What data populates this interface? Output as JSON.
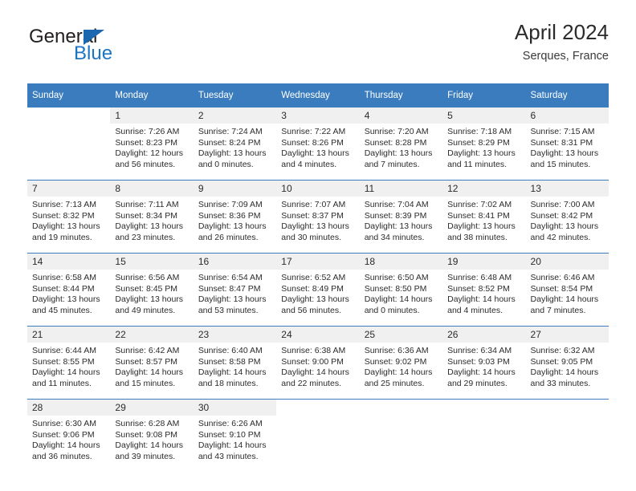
{
  "brand": {
    "name_top": "General",
    "name_bottom": "Blue",
    "triangle_color": "#1c68b0",
    "blue_color": "#1c74c4"
  },
  "header": {
    "title": "April 2024",
    "location": "Serques, France"
  },
  "theme": {
    "header_row_bg": "#3a7cbe",
    "daynum_bg": "#f0f0f0",
    "text_color": "#2b2b2b"
  },
  "weekday_headers": [
    "Sunday",
    "Monday",
    "Tuesday",
    "Wednesday",
    "Thursday",
    "Friday",
    "Saturday"
  ],
  "labels": {
    "sunrise_prefix": "Sunrise:",
    "sunset_prefix": "Sunset:",
    "daylight_prefix": "Daylight:"
  },
  "weeks": [
    [
      {
        "day": "",
        "sunrise": "",
        "sunset": "",
        "daylight": ""
      },
      {
        "day": "1",
        "sunrise": "Sunrise: 7:26 AM",
        "sunset": "Sunset: 8:23 PM",
        "daylight": "Daylight: 12 hours and 56 minutes."
      },
      {
        "day": "2",
        "sunrise": "Sunrise: 7:24 AM",
        "sunset": "Sunset: 8:24 PM",
        "daylight": "Daylight: 13 hours and 0 minutes."
      },
      {
        "day": "3",
        "sunrise": "Sunrise: 7:22 AM",
        "sunset": "Sunset: 8:26 PM",
        "daylight": "Daylight: 13 hours and 4 minutes."
      },
      {
        "day": "4",
        "sunrise": "Sunrise: 7:20 AM",
        "sunset": "Sunset: 8:28 PM",
        "daylight": "Daylight: 13 hours and 7 minutes."
      },
      {
        "day": "5",
        "sunrise": "Sunrise: 7:18 AM",
        "sunset": "Sunset: 8:29 PM",
        "daylight": "Daylight: 13 hours and 11 minutes."
      },
      {
        "day": "6",
        "sunrise": "Sunrise: 7:15 AM",
        "sunset": "Sunset: 8:31 PM",
        "daylight": "Daylight: 13 hours and 15 minutes."
      }
    ],
    [
      {
        "day": "7",
        "sunrise": "Sunrise: 7:13 AM",
        "sunset": "Sunset: 8:32 PM",
        "daylight": "Daylight: 13 hours and 19 minutes."
      },
      {
        "day": "8",
        "sunrise": "Sunrise: 7:11 AM",
        "sunset": "Sunset: 8:34 PM",
        "daylight": "Daylight: 13 hours and 23 minutes."
      },
      {
        "day": "9",
        "sunrise": "Sunrise: 7:09 AM",
        "sunset": "Sunset: 8:36 PM",
        "daylight": "Daylight: 13 hours and 26 minutes."
      },
      {
        "day": "10",
        "sunrise": "Sunrise: 7:07 AM",
        "sunset": "Sunset: 8:37 PM",
        "daylight": "Daylight: 13 hours and 30 minutes."
      },
      {
        "day": "11",
        "sunrise": "Sunrise: 7:04 AM",
        "sunset": "Sunset: 8:39 PM",
        "daylight": "Daylight: 13 hours and 34 minutes."
      },
      {
        "day": "12",
        "sunrise": "Sunrise: 7:02 AM",
        "sunset": "Sunset: 8:41 PM",
        "daylight": "Daylight: 13 hours and 38 minutes."
      },
      {
        "day": "13",
        "sunrise": "Sunrise: 7:00 AM",
        "sunset": "Sunset: 8:42 PM",
        "daylight": "Daylight: 13 hours and 42 minutes."
      }
    ],
    [
      {
        "day": "14",
        "sunrise": "Sunrise: 6:58 AM",
        "sunset": "Sunset: 8:44 PM",
        "daylight": "Daylight: 13 hours and 45 minutes."
      },
      {
        "day": "15",
        "sunrise": "Sunrise: 6:56 AM",
        "sunset": "Sunset: 8:45 PM",
        "daylight": "Daylight: 13 hours and 49 minutes."
      },
      {
        "day": "16",
        "sunrise": "Sunrise: 6:54 AM",
        "sunset": "Sunset: 8:47 PM",
        "daylight": "Daylight: 13 hours and 53 minutes."
      },
      {
        "day": "17",
        "sunrise": "Sunrise: 6:52 AM",
        "sunset": "Sunset: 8:49 PM",
        "daylight": "Daylight: 13 hours and 56 minutes."
      },
      {
        "day": "18",
        "sunrise": "Sunrise: 6:50 AM",
        "sunset": "Sunset: 8:50 PM",
        "daylight": "Daylight: 14 hours and 0 minutes."
      },
      {
        "day": "19",
        "sunrise": "Sunrise: 6:48 AM",
        "sunset": "Sunset: 8:52 PM",
        "daylight": "Daylight: 14 hours and 4 minutes."
      },
      {
        "day": "20",
        "sunrise": "Sunrise: 6:46 AM",
        "sunset": "Sunset: 8:54 PM",
        "daylight": "Daylight: 14 hours and 7 minutes."
      }
    ],
    [
      {
        "day": "21",
        "sunrise": "Sunrise: 6:44 AM",
        "sunset": "Sunset: 8:55 PM",
        "daylight": "Daylight: 14 hours and 11 minutes."
      },
      {
        "day": "22",
        "sunrise": "Sunrise: 6:42 AM",
        "sunset": "Sunset: 8:57 PM",
        "daylight": "Daylight: 14 hours and 15 minutes."
      },
      {
        "day": "23",
        "sunrise": "Sunrise: 6:40 AM",
        "sunset": "Sunset: 8:58 PM",
        "daylight": "Daylight: 14 hours and 18 minutes."
      },
      {
        "day": "24",
        "sunrise": "Sunrise: 6:38 AM",
        "sunset": "Sunset: 9:00 PM",
        "daylight": "Daylight: 14 hours and 22 minutes."
      },
      {
        "day": "25",
        "sunrise": "Sunrise: 6:36 AM",
        "sunset": "Sunset: 9:02 PM",
        "daylight": "Daylight: 14 hours and 25 minutes."
      },
      {
        "day": "26",
        "sunrise": "Sunrise: 6:34 AM",
        "sunset": "Sunset: 9:03 PM",
        "daylight": "Daylight: 14 hours and 29 minutes."
      },
      {
        "day": "27",
        "sunrise": "Sunrise: 6:32 AM",
        "sunset": "Sunset: 9:05 PM",
        "daylight": "Daylight: 14 hours and 33 minutes."
      }
    ],
    [
      {
        "day": "28",
        "sunrise": "Sunrise: 6:30 AM",
        "sunset": "Sunset: 9:06 PM",
        "daylight": "Daylight: 14 hours and 36 minutes."
      },
      {
        "day": "29",
        "sunrise": "Sunrise: 6:28 AM",
        "sunset": "Sunset: 9:08 PM",
        "daylight": "Daylight: 14 hours and 39 minutes."
      },
      {
        "day": "30",
        "sunrise": "Sunrise: 6:26 AM",
        "sunset": "Sunset: 9:10 PM",
        "daylight": "Daylight: 14 hours and 43 minutes."
      },
      {
        "day": "",
        "sunrise": "",
        "sunset": "",
        "daylight": ""
      },
      {
        "day": "",
        "sunrise": "",
        "sunset": "",
        "daylight": ""
      },
      {
        "day": "",
        "sunrise": "",
        "sunset": "",
        "daylight": ""
      },
      {
        "day": "",
        "sunrise": "",
        "sunset": "",
        "daylight": ""
      }
    ]
  ]
}
